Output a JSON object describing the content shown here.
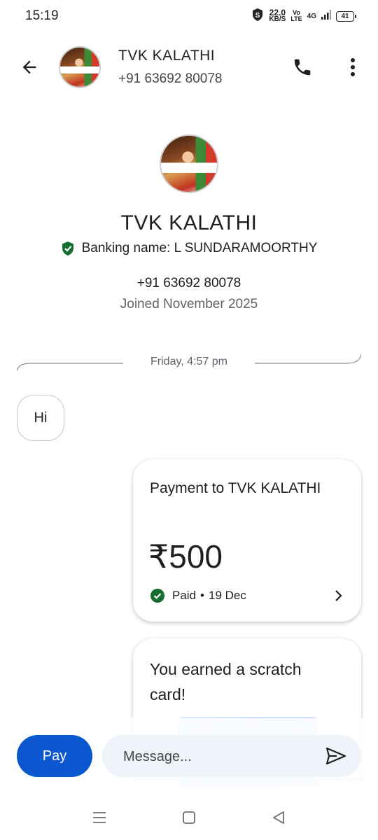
{
  "status_bar": {
    "time": "15:19",
    "speed_value": "22.0",
    "speed_unit": "KB/S",
    "volte_top": "Vo",
    "volte_bottom": "LTE",
    "network": "4G",
    "battery": "41"
  },
  "header": {
    "contact_name": "TVK KALATHI",
    "contact_phone": "+91 63692 80078"
  },
  "profile": {
    "name": "TVK KALATHI",
    "banking_name": "Banking name: L SUNDARAMOORTHY",
    "phone": "+91 63692 80078",
    "joined": "Joined November 2025"
  },
  "conversation": {
    "date_label": "Friday, 4:57 pm",
    "incoming_message": "Hi",
    "payment": {
      "title": "Payment to TVK KALATHI",
      "amount": "₹500",
      "status": "Paid",
      "separator": "•",
      "date": "19 Dec"
    },
    "scratch_card": {
      "title": "You earned a scratch card!"
    }
  },
  "composer": {
    "pay_label": "Pay",
    "message_placeholder": "Message..."
  },
  "colors": {
    "accent": "#0b57d0",
    "verified_green": "#146c2e",
    "composer_bg": "#eff3fa"
  },
  "icons": {
    "back": "arrow-back-icon",
    "call": "phone-icon",
    "more": "more-vert-icon",
    "verified": "shield-check-icon",
    "paid": "check-circle-icon",
    "send": "send-icon",
    "nav_recents": "menu-icon",
    "nav_home": "home-icon",
    "nav_back": "triangle-back-icon"
  }
}
